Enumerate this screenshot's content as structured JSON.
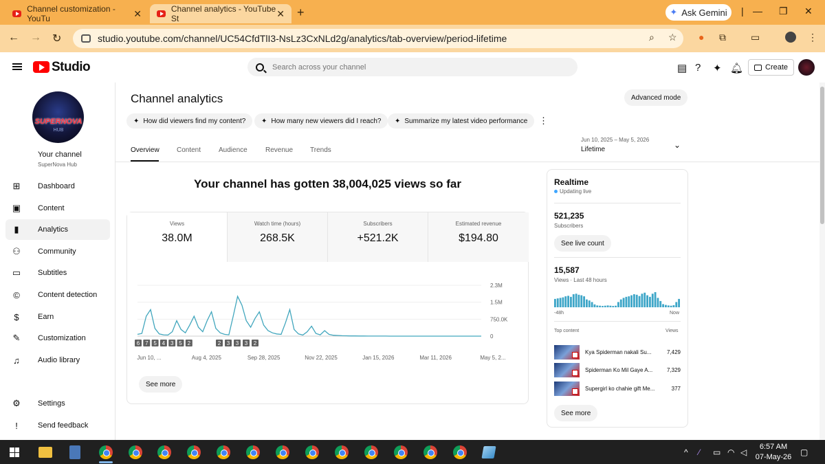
{
  "browser": {
    "tabs": [
      {
        "title": "Channel customization - YouTu",
        "active": false
      },
      {
        "title": "Channel analytics - YouTube St",
        "active": true
      }
    ],
    "ask_gemini": "Ask Gemini",
    "url": "studio.youtube.com/channel/UC54CfdTlI3-NsLz3CxNLd2g/analytics/tab-overview/period-lifetime"
  },
  "header": {
    "logo": "Studio",
    "search_placeholder": "Search across your channel",
    "create_label": "Create"
  },
  "sidebar": {
    "your_channel": "Your channel",
    "channel_name": "SuperNova Hub",
    "avatar_text": "SUPERNOVA",
    "avatar_subtext": "HUB",
    "items": [
      {
        "label": "Dashboard",
        "icon": "dashboard-icon"
      },
      {
        "label": "Content",
        "icon": "content-icon"
      },
      {
        "label": "Analytics",
        "icon": "analytics-icon",
        "active": true
      },
      {
        "label": "Community",
        "icon": "community-icon"
      },
      {
        "label": "Subtitles",
        "icon": "subtitles-icon"
      },
      {
        "label": "Content detection",
        "icon": "copyright-icon"
      },
      {
        "label": "Earn",
        "icon": "earn-icon"
      },
      {
        "label": "Customization",
        "icon": "customization-icon"
      },
      {
        "label": "Audio library",
        "icon": "audio-library-icon"
      }
    ],
    "settings": "Settings",
    "feedback": "Send feedback"
  },
  "main": {
    "title": "Channel analytics",
    "advanced_mode": "Advanced mode",
    "chips": [
      "How did viewers find my content?",
      "How many new viewers did I reach?",
      "Summarize my latest video performance"
    ],
    "tabs": [
      "Overview",
      "Content",
      "Audience",
      "Revenue",
      "Trends"
    ],
    "date_range": "Jun 10, 2025 – May 5, 2026",
    "period": "Lifetime",
    "headline": "Your channel has gotten 38,004,025 views so far",
    "kpis": [
      {
        "label": "Views",
        "value": "38.0M"
      },
      {
        "label": "Watch time (hours)",
        "value": "268.5K"
      },
      {
        "label": "Subscribers",
        "value": "+521.2K"
      },
      {
        "label": "Estimated revenue",
        "value": "$194.80"
      }
    ],
    "see_more": "See more"
  },
  "chart_data": {
    "type": "line",
    "x_tick_labels": [
      "Jun 10, ...",
      "Aug 4, 2025",
      "Sep 28, 2025",
      "Nov 22, 2025",
      "Jan 15, 2026",
      "Mar 11, 2026",
      "May 5, 2..."
    ],
    "y_tick_labels": [
      "2.3M",
      "1.5M",
      "750.0K",
      "0"
    ],
    "ylim": [
      0,
      2300000
    ],
    "video_markers": [
      "6",
      "7",
      "5",
      "4",
      "3",
      "5",
      "2",
      "2",
      "3",
      "3",
      "3",
      "2"
    ],
    "series": [
      {
        "values": [
          80000,
          120000,
          900000,
          1200000,
          350000,
          100000,
          60000,
          50000,
          200000,
          700000,
          300000,
          150000,
          500000,
          900000,
          400000,
          200000,
          700000,
          1100000,
          350000,
          150000,
          80000,
          60000,
          900000,
          1800000,
          1400000,
          700000,
          400000,
          800000,
          1100000,
          500000,
          250000,
          150000,
          100000,
          80000,
          600000,
          1200000,
          300000,
          100000,
          50000,
          200000,
          450000,
          120000,
          60000,
          250000,
          80000,
          40000,
          30000,
          20000,
          15000,
          10000,
          8000,
          6000,
          5000,
          4000,
          3000,
          2500,
          2000,
          2000,
          1500,
          1500,
          1200,
          1000,
          1000,
          900,
          800,
          800,
          700,
          700,
          600,
          600,
          500,
          500,
          500,
          400,
          400,
          400,
          300,
          300,
          300,
          300
        ]
      }
    ]
  },
  "realtime": {
    "title": "Realtime",
    "status": "Updating live",
    "subs_value": "521,235",
    "subs_label": "Subscribers",
    "see_live": "See live count",
    "views_value": "15,587",
    "views_label": "Views · Last 48 hours",
    "axis_start": "-48h",
    "axis_end": "Now",
    "hourly_views": [
      320,
      340,
      360,
      380,
      420,
      440,
      400,
      500,
      520,
      480,
      460,
      420,
      300,
      260,
      200,
      110,
      70,
      60,
      50,
      60,
      70,
      60,
      50,
      60,
      200,
      300,
      360,
      400,
      420,
      460,
      500,
      480,
      430,
      520,
      560,
      460,
      400,
      520,
      580,
      360,
      240,
      120,
      90,
      70,
      60,
      80,
      200,
      320
    ],
    "top_content_label": "Top content",
    "views_col": "Views",
    "top_content": [
      {
        "title": "Kya Spiderman nakali Su...",
        "views": "7,429"
      },
      {
        "title": "Spiderman Ko Mil Gaye A...",
        "views": "7,329"
      },
      {
        "title": "Supergirl ko chahie gift Me...",
        "views": "377"
      }
    ],
    "see_more": "See more"
  },
  "taskbar": {
    "time": "6:57 AM",
    "date": "07-May-26"
  }
}
